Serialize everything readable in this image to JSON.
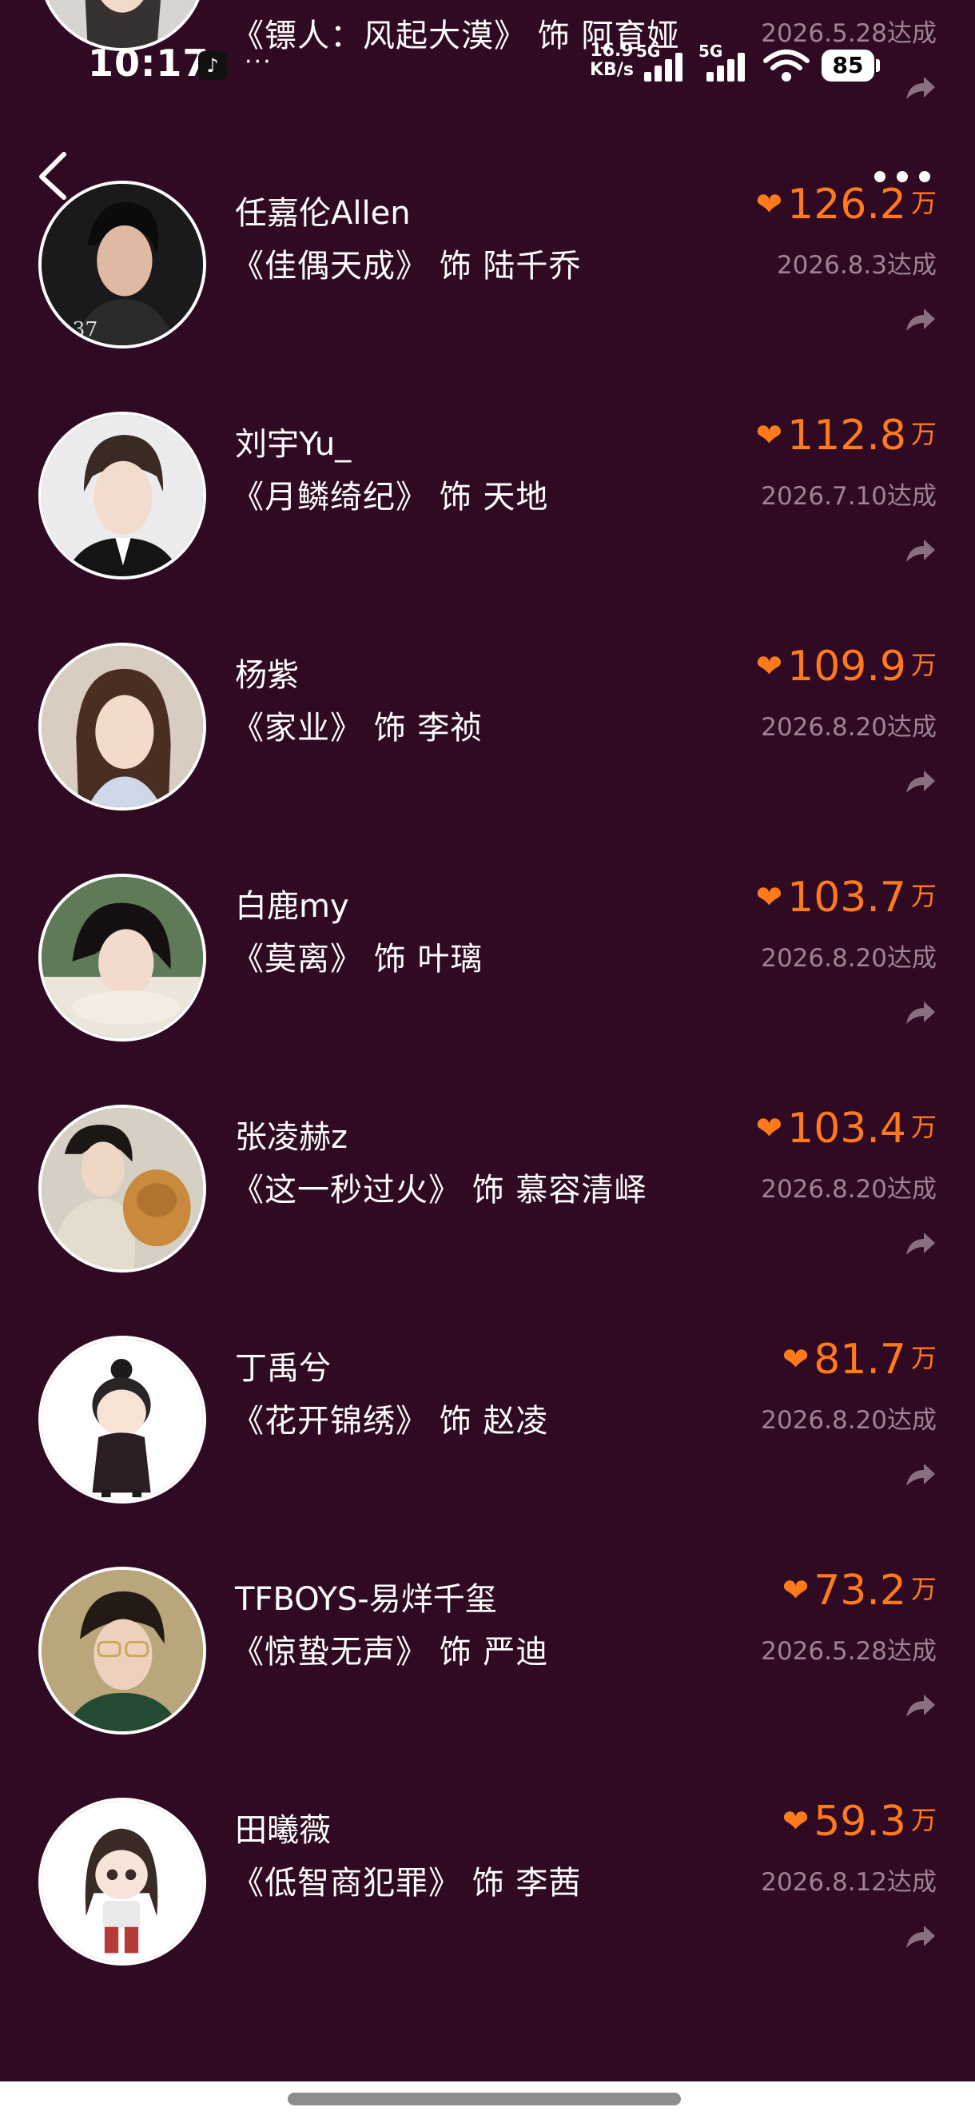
{
  "status_bar": {
    "time": "10:17",
    "more": "···",
    "net_speed_value": "16.9",
    "net_speed_unit": "KB/s",
    "network_1": "5G",
    "network_2": "5G",
    "battery": "85"
  },
  "colors": {
    "background": "#2f0a22",
    "likes_accent": "#ff7a1a",
    "date_text": "#9d8394",
    "share_icon": "#8a6f80"
  },
  "items": [
    {
      "name": "",
      "role": "《镖人：风起大漠》 饰 阿育娅",
      "likes": "",
      "unit": "",
      "date": "2026.5.28达成"
    },
    {
      "name": "任嘉伦Allen",
      "role": "《佳偶天成》 饰 陆千乔",
      "likes": "126.2",
      "unit": "万",
      "date": "2026.8.3达成"
    },
    {
      "name": "刘宇Yu_",
      "role": "《月鳞绮纪》 饰 天地",
      "likes": "112.8",
      "unit": "万",
      "date": "2026.7.10达成"
    },
    {
      "name": "杨紫",
      "role": "《家业》 饰 李祯",
      "likes": "109.9",
      "unit": "万",
      "date": "2026.8.20达成"
    },
    {
      "name": "白鹿my",
      "role": "《莫离》 饰 叶璃",
      "likes": "103.7",
      "unit": "万",
      "date": "2026.8.20达成"
    },
    {
      "name": "张凌赫z",
      "role": "《这一秒过火》 饰 慕容清峄",
      "likes": "103.4",
      "unit": "万",
      "date": "2026.8.20达成"
    },
    {
      "name": "丁禹兮",
      "role": "《花开锦绣》 饰 赵凌",
      "likes": "81.7",
      "unit": "万",
      "date": "2026.8.20达成"
    },
    {
      "name": "TFBOYS-易烊千玺",
      "role": "《惊蛰无声》 饰 严迪",
      "likes": "73.2",
      "unit": "万",
      "date": "2026.5.28达成"
    },
    {
      "name": "田曦薇",
      "role": "《低智商犯罪》 饰 李茜",
      "likes": "59.3",
      "unit": "万",
      "date": "2026.8.12达成"
    }
  ]
}
